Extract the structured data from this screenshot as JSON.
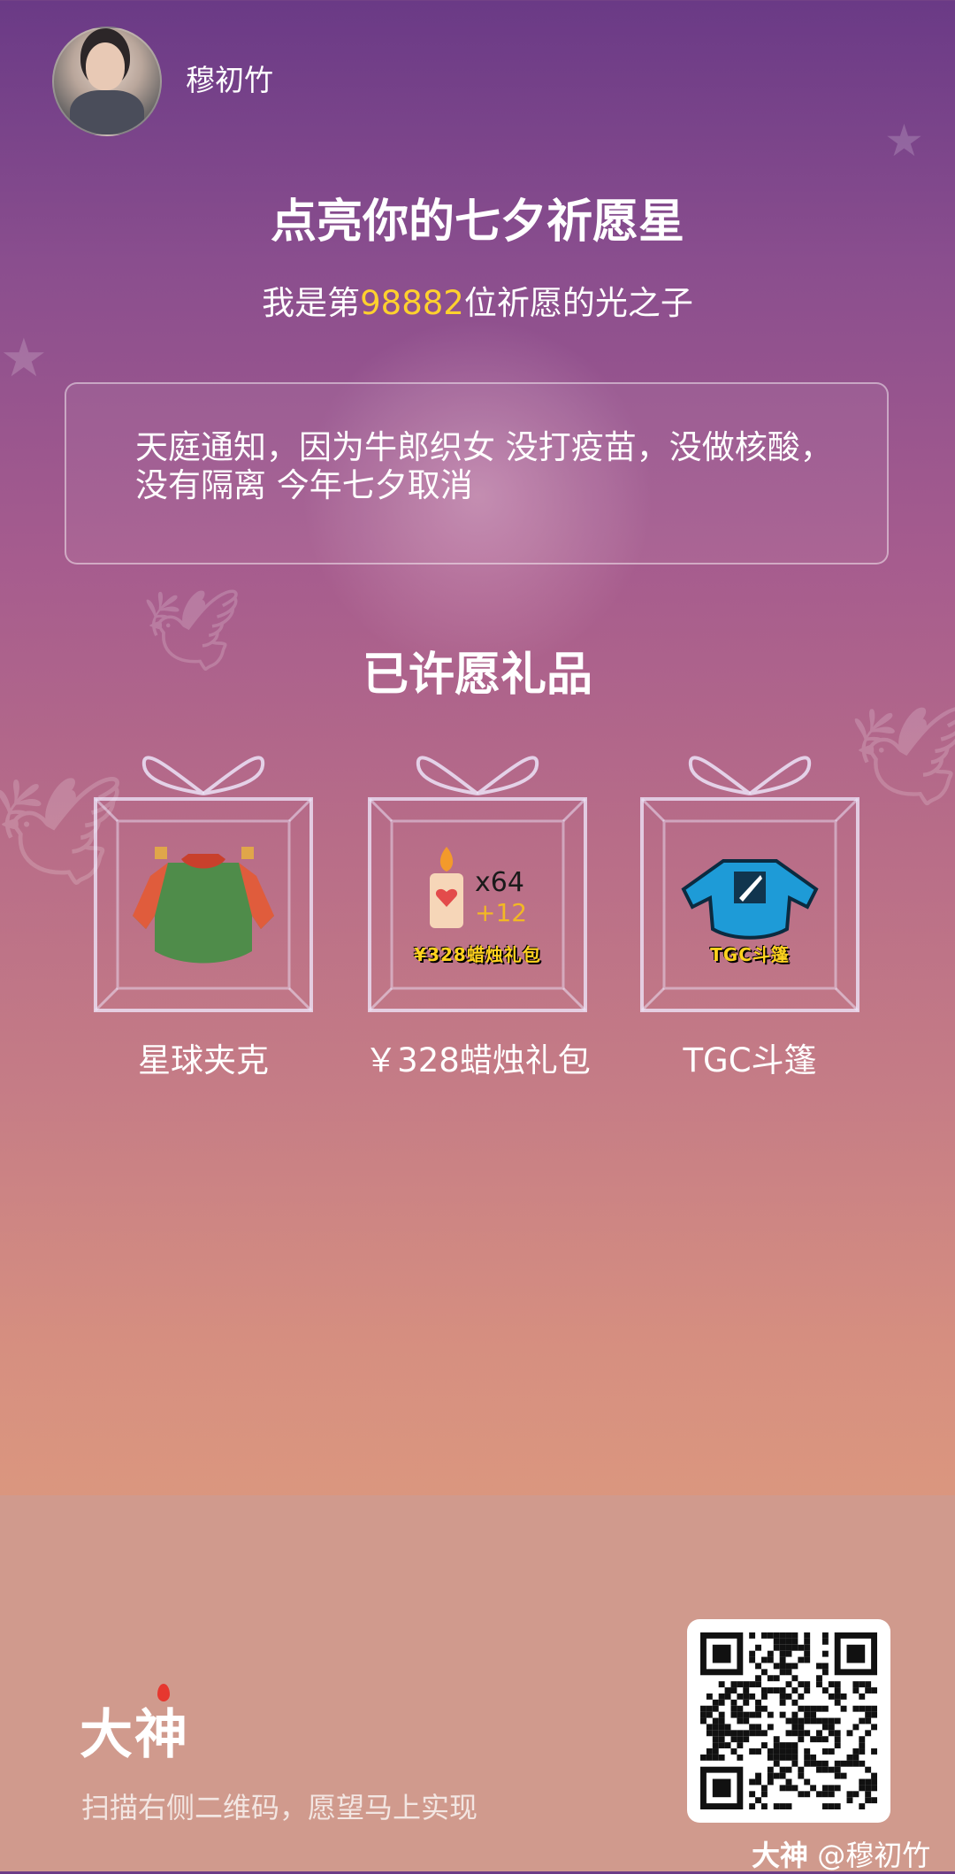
{
  "user": {
    "name": "穆初竹"
  },
  "hero": {
    "title": "点亮你的七夕祈愿星",
    "subtitle_prefix": "我是第",
    "subtitle_number": "98882",
    "subtitle_suffix": "位祈愿的光之子"
  },
  "wish": {
    "text": "天庭通知，因为牛郎织女 没打疫苗，没做核酸，没有隔离 今年七夕取消"
  },
  "gifts": {
    "section_title": "已许愿礼品",
    "items": [
      {
        "label": "星球夹克"
      },
      {
        "label": "￥328蜡烛礼包",
        "count": "x64",
        "bonus": "+12",
        "badge": "¥328蜡烛礼包"
      },
      {
        "label": "TGC斗篷",
        "badge": "TGC斗篷"
      }
    ]
  },
  "footer": {
    "brand": "大神",
    "tagline": "扫描右侧二维码，愿望马上实现",
    "watermark_brand": "大神",
    "watermark_user": "@穆初竹"
  },
  "colors": {
    "highlight": "#ffd12e",
    "bonus": "#f2b824"
  }
}
